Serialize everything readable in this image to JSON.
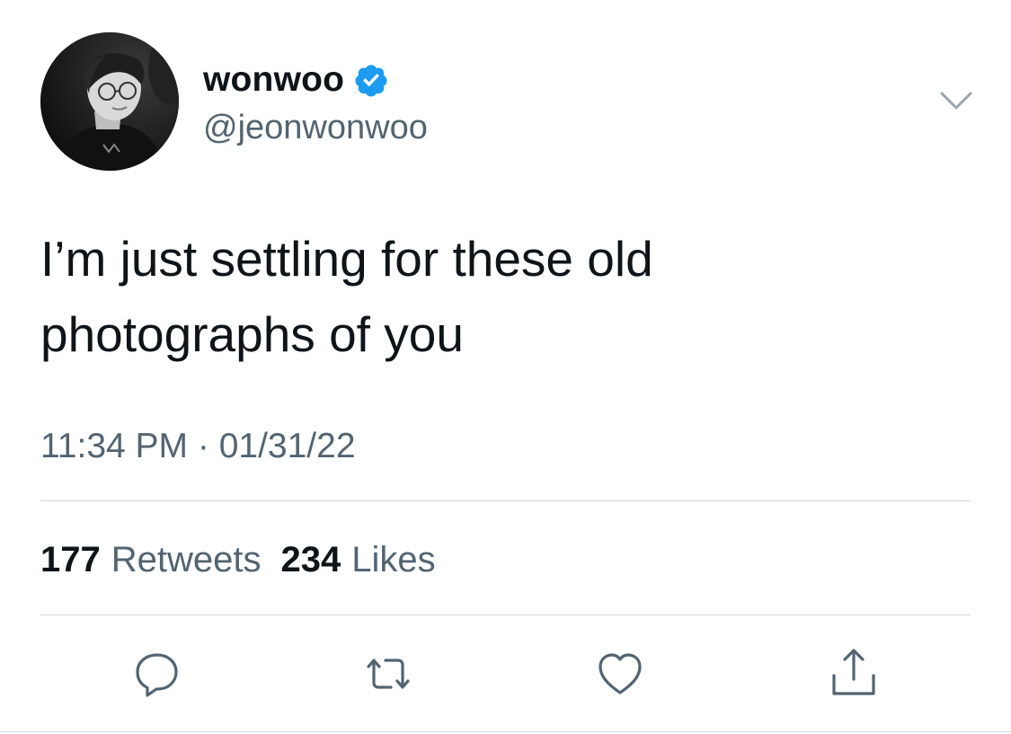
{
  "user": {
    "display_name": "wonwoo",
    "handle": "@jeonwonwoo",
    "verified": true
  },
  "tweet": {
    "text_lines": [
      "I’m just settling for these old",
      "photographs of you"
    ],
    "timestamp": "11:34 PM · 01/31/22"
  },
  "stats": {
    "retweets_count": "177",
    "retweets_label": "Retweets",
    "likes_count": "234",
    "likes_label": "Likes"
  },
  "icons": {
    "verified": "verified-badge-icon",
    "menu": "chevron-down-icon",
    "reply": "reply-icon",
    "retweet": "retweet-icon",
    "like": "heart-icon",
    "share": "share-icon"
  },
  "colors": {
    "verified_blue": "#1d9bf0",
    "secondary_text": "#536471",
    "primary_text": "#0f1419",
    "divider": "#cfd9de"
  }
}
